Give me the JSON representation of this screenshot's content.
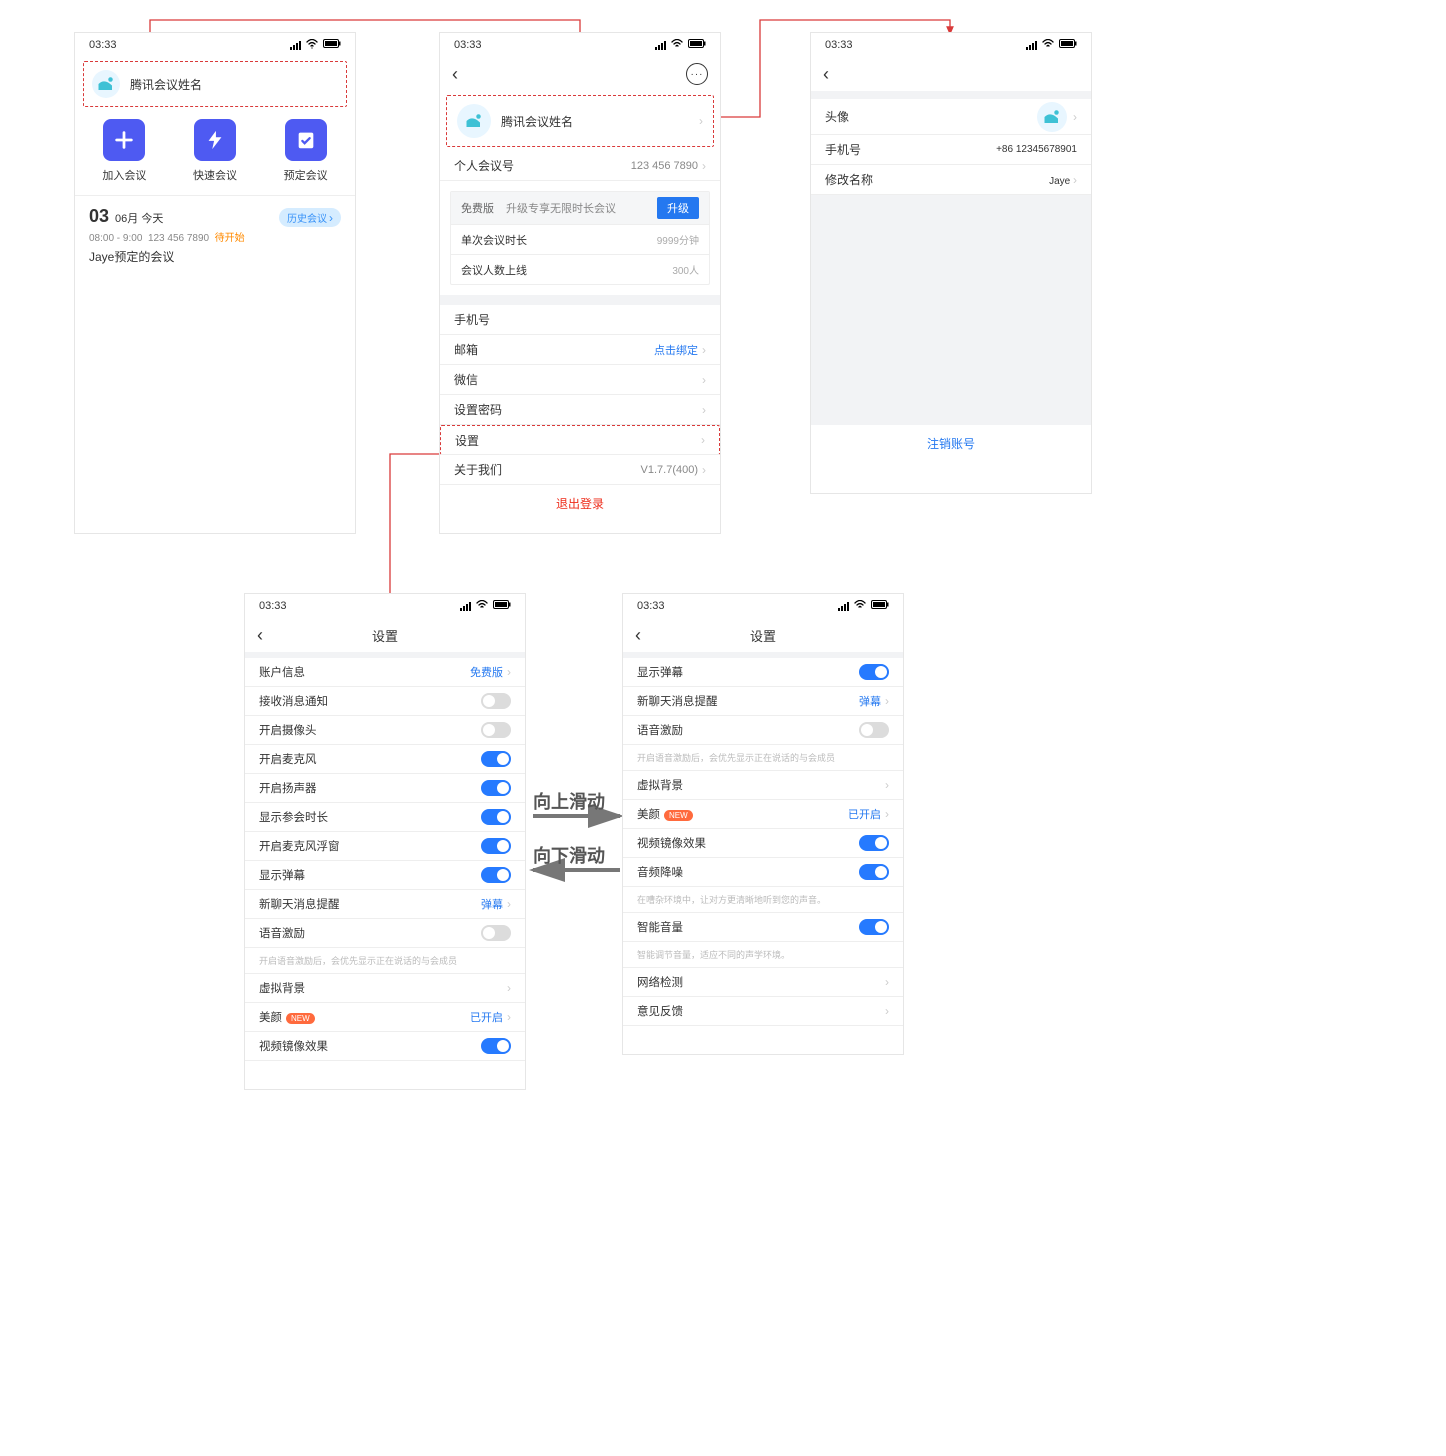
{
  "status_time": "03:33",
  "screen1": {
    "profile_name": "腾讯会议姓名",
    "actions": {
      "join": "加入会议",
      "quick": "快速会议",
      "schedule": "预定会议"
    },
    "date_big": "03",
    "date_small": "06月 今天",
    "history_pill": "历史会议",
    "meet_time": "08:00 - 9:00",
    "meet_id": "123 456 7890",
    "meet_status": "待开始",
    "meet_name": "Jaye预定的会议"
  },
  "screen2": {
    "profile_name": "腾讯会议姓名",
    "personal_id_label": "个人会议号",
    "personal_id": "123 456 7890",
    "free_label": "免费版",
    "free_desc": "升级专享无限时长会议",
    "upgrade": "升级",
    "limit_duration_label": "单次会议时长",
    "limit_duration": "9999分钟",
    "limit_people_label": "会议人数上线",
    "limit_people": "300人",
    "rows": {
      "phone": "手机号",
      "phone_val": "",
      "email": "邮箱",
      "email_val": "点击绑定",
      "wechat": "微信",
      "password": "设置密码",
      "settings": "设置",
      "about": "关于我们",
      "about_val": "V1.7.7(400)"
    },
    "logout": "退出登录"
  },
  "screen3": {
    "avatar_label": "头像",
    "phone_label": "手机号",
    "phone_val": "+86 12345678901",
    "rename_label": "修改名称",
    "rename_val": "Jaye",
    "deactivate": "注销账号"
  },
  "settings_title": "设置",
  "screen4": {
    "items": [
      {
        "l": "账户信息",
        "r": "免费版",
        "rtype": "link",
        "chev": true
      },
      {
        "l": "接收消息通知",
        "rtype": "switch",
        "on": false
      },
      {
        "l": "开启摄像头",
        "rtype": "switch",
        "on": false
      },
      {
        "l": "开启麦克风",
        "rtype": "switch",
        "on": true
      },
      {
        "l": "开启扬声器",
        "rtype": "switch",
        "on": true
      },
      {
        "l": "显示参会时长",
        "rtype": "switch",
        "on": true
      },
      {
        "l": "开启麦克风浮窗",
        "rtype": "switch",
        "on": true
      },
      {
        "l": "显示弹幕",
        "rtype": "switch",
        "on": true
      },
      {
        "l": "新聊天消息提醒",
        "r": "弹幕",
        "rtype": "link",
        "chev": true
      },
      {
        "l": "语音激励",
        "rtype": "switch",
        "on": false
      },
      {
        "hint": "开启语音激励后，会优先显示正在说话的与会成员"
      },
      {
        "l": "虚拟背景",
        "rtype": "link",
        "chev": true
      },
      {
        "l": "美颜",
        "badge": "NEW",
        "r": "已开启",
        "rtype": "link",
        "chev": true,
        "rblue": true
      },
      {
        "l": "视频镜像效果",
        "rtype": "switch",
        "on": true
      }
    ]
  },
  "screen5": {
    "items": [
      {
        "l": "显示弹幕",
        "rtype": "switch",
        "on": true
      },
      {
        "l": "新聊天消息提醒",
        "r": "弹幕",
        "rtype": "link",
        "chev": true,
        "rblue": true
      },
      {
        "l": "语音激励",
        "rtype": "switch",
        "on": false
      },
      {
        "hint": "开启语音激励后，会优先显示正在说话的与会成员"
      },
      {
        "l": "虚拟背景",
        "rtype": "link",
        "chev": true
      },
      {
        "l": "美颜",
        "badge": "NEW",
        "r": "已开启",
        "rtype": "link",
        "chev": true,
        "rblue": true
      },
      {
        "l": "视频镜像效果",
        "rtype": "switch",
        "on": true
      },
      {
        "l": "音频降噪",
        "rtype": "switch",
        "on": true
      },
      {
        "hint": "在嘈杂环境中，让对方更清晰地听到您的声音。"
      },
      {
        "l": "智能音量",
        "rtype": "switch",
        "on": true
      },
      {
        "hint": "智能调节音量，适应不同的声学环境。"
      },
      {
        "l": "网络检测",
        "rtype": "link",
        "chev": true
      },
      {
        "l": "意见反馈",
        "rtype": "link",
        "chev": true
      }
    ]
  },
  "swipe_up": "向上滑动",
  "swipe_down": "向下滑动"
}
